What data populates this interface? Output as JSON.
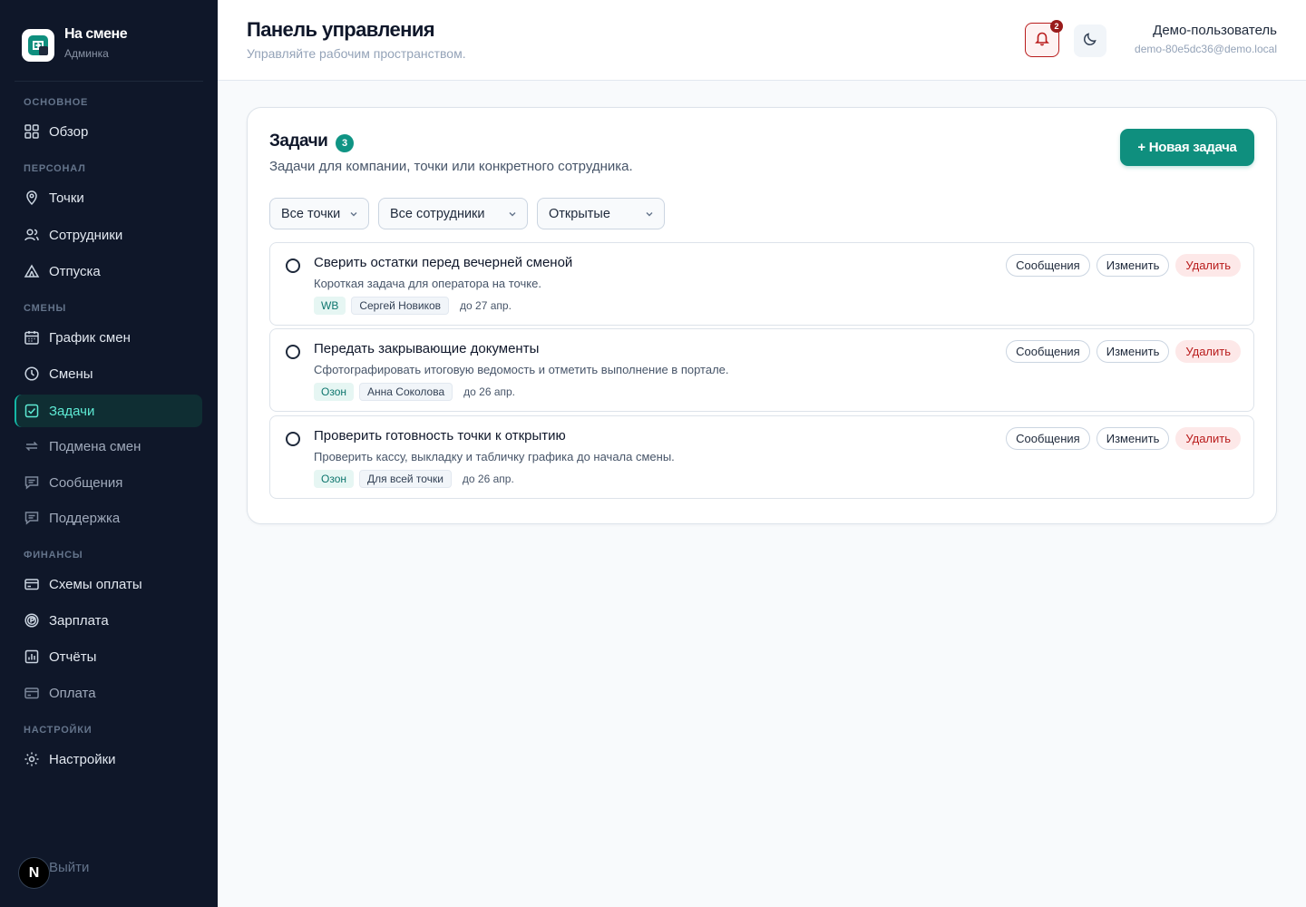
{
  "brand": {
    "title": "На смене",
    "subtitle": "Админка"
  },
  "nav": {
    "sections": {
      "main": "ОСНОВНОЕ",
      "staff": "ПЕРСОНАЛ",
      "shifts": "СМЕНЫ",
      "finance": "ФИНАНСЫ",
      "settings": "НАСТРОЙКИ"
    },
    "items": {
      "overview": "Обзор",
      "points": "Точки",
      "employees": "Сотрудники",
      "vacations": "Отпуска",
      "schedule": "График смен",
      "shifts": "Смены",
      "tasks": "Задачи",
      "swap": "Подмена смен",
      "messages": "Сообщения",
      "support": "Поддержка",
      "pay_schemes": "Схемы оплаты",
      "salary": "Зарплата",
      "reports": "Отчёты",
      "payment": "Оплата",
      "settings": "Настройки"
    },
    "logout": "Выйти",
    "dev_badge": "N"
  },
  "header": {
    "title": "Панель управления",
    "subtitle": "Управляйте рабочим пространством.",
    "notifications_count": "2",
    "user_name": "Демо-пользователь",
    "user_email": "demo-80e5dc36@demo.local"
  },
  "tasks_card": {
    "title": "Задачи",
    "count": "3",
    "subtitle": "Задачи для компании, точки или конкретного сотрудника.",
    "new_button": "+ Новая задача",
    "filters": {
      "points": "Все точки",
      "employees": "Все сотрудники",
      "status": "Открытые"
    },
    "action_labels": {
      "messages": "Сообщения",
      "edit": "Изменить",
      "delete": "Удалить"
    },
    "items": [
      {
        "title": "Сверить остатки перед вечерней сменой",
        "description": "Короткая задача для оператора на точке.",
        "point": "WB",
        "assignee": "Сергей Новиков",
        "due": "до 27 апр."
      },
      {
        "title": "Передать закрывающие документы",
        "description": "Сфотографировать итоговую ведомость и отметить выполнение в портале.",
        "point": "Озон",
        "assignee": "Анна Соколова",
        "due": "до 26 апр."
      },
      {
        "title": "Проверить готовность точки к открытию",
        "description": "Проверить кассу, выкладку и табличку графика до начала смены.",
        "point": "Озон",
        "assignee": "Для всей точки",
        "due": "до 26 апр."
      }
    ]
  },
  "colors": {
    "sidebar_bg": "#0f1729",
    "accent": "#0f8f7e",
    "active_nav_text": "#5eead4",
    "danger": "#b91c1c"
  }
}
